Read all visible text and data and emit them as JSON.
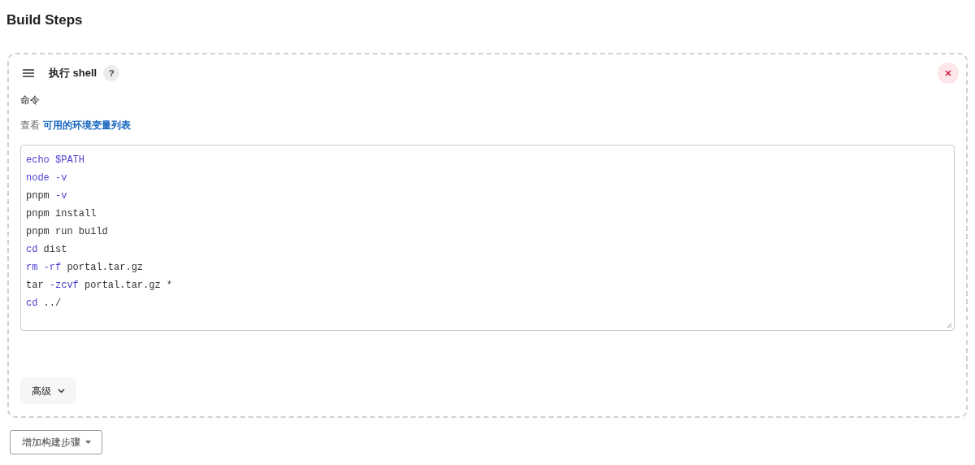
{
  "section_title": "Build Steps",
  "step": {
    "title": "执行 shell",
    "help": "?",
    "command_label": "命令",
    "env_hint": {
      "prefix": "查看",
      "link": "可用的环境变量列表"
    },
    "code_lines": [
      [
        {
          "text": "echo $PATH",
          "kind": "keyword"
        }
      ],
      [
        {
          "text": "node -v",
          "kind": "keyword"
        }
      ],
      [
        {
          "text": "pnpm ",
          "kind": "plain"
        },
        {
          "text": "-v",
          "kind": "keyword"
        }
      ],
      [
        {
          "text": "pnpm install",
          "kind": "plain"
        }
      ],
      [
        {
          "text": "pnpm run build",
          "kind": "plain"
        }
      ],
      [
        {
          "text": "cd",
          "kind": "keyword"
        },
        {
          "text": " dist",
          "kind": "plain"
        }
      ],
      [
        {
          "text": "rm -rf",
          "kind": "keyword"
        },
        {
          "text": " portal.tar.gz",
          "kind": "plain"
        }
      ],
      [
        {
          "text": "tar ",
          "kind": "plain"
        },
        {
          "text": "-zcvf",
          "kind": "keyword"
        },
        {
          "text": " portal.tar.gz *",
          "kind": "plain"
        }
      ],
      [
        {
          "text": "cd",
          "kind": "keyword"
        },
        {
          "text": " ../",
          "kind": "plain"
        }
      ]
    ],
    "advanced": {
      "label": "高级",
      "expanded": false
    }
  },
  "add_step_button": "增加构建步骤"
}
